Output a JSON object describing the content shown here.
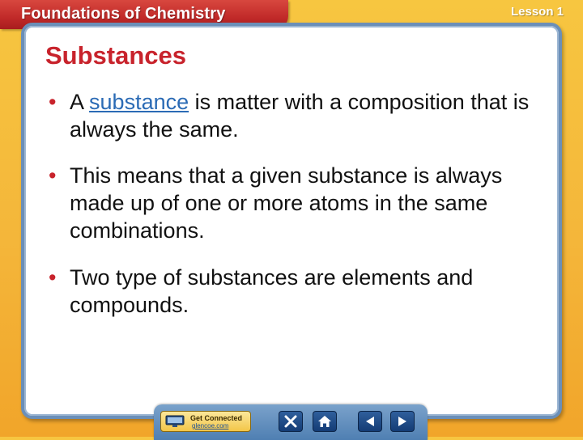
{
  "header": {
    "title": "Foundations of Chemistry",
    "lesson": "Lesson 1"
  },
  "slide": {
    "title": "Substances",
    "bullets": [
      {
        "link_text": "substance",
        "before_link": "A ",
        "after_link": " is matter with a composition that is always the same."
      },
      {
        "text": "This means that a given substance is always made up of one or more atoms in the same combinations."
      },
      {
        "text": "Two type of substances are elements and compounds."
      }
    ]
  },
  "nav": {
    "get_connected_label": "Get Connected",
    "get_connected_sub": "glencoe.com",
    "icons": [
      "monitor-icon",
      "close-icon",
      "home-icon",
      "previous-arrow-icon",
      "next-arrow-icon"
    ]
  },
  "colors": {
    "header_red": "#c12a29",
    "title_red": "#c8232c",
    "link_blue": "#2b6bb5",
    "background_gold": "#f4b63a",
    "panel_border_blue": "#6b8fb8"
  }
}
